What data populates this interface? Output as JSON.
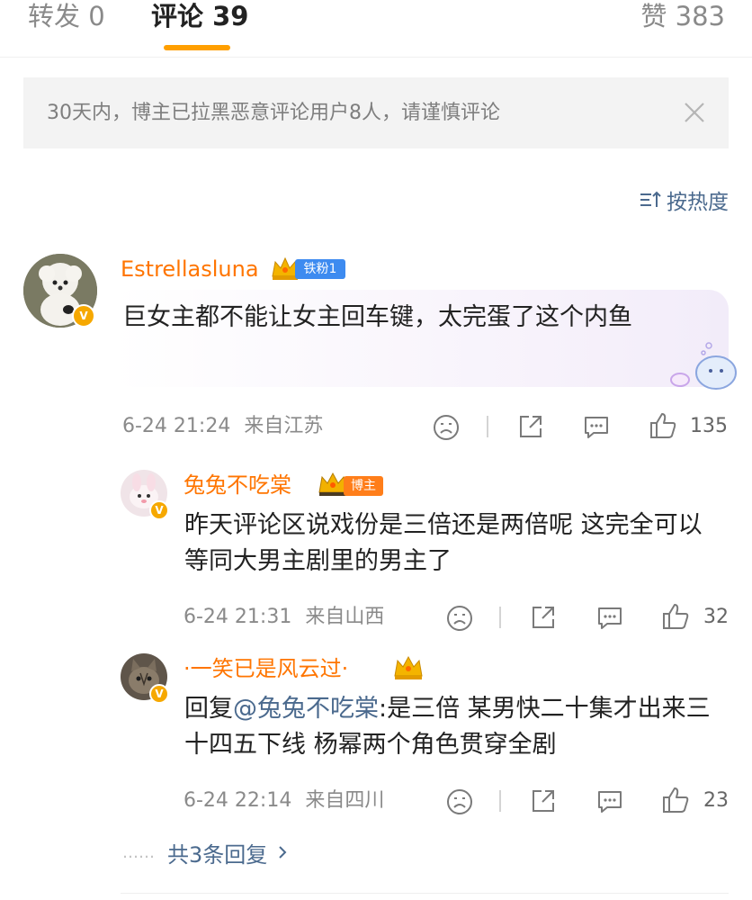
{
  "tabs": {
    "repost": "转发 0",
    "comments": "评论 39",
    "likes": "赞 383"
  },
  "notice": {
    "text": "30天内，博主已拉黑恶意评论用户8人，请谨慎评论"
  },
  "sort": {
    "label": "按热度"
  },
  "comments": [
    {
      "user": "Estrellasluna",
      "fan_badge": "铁粉1",
      "text": "巨女主都不能让女主回车键，太完蛋了这个内鱼",
      "time": "6-24 21:24",
      "location": "来自江苏",
      "likes": "135"
    },
    {
      "user": "兔兔不吃棠",
      "fan_badge": "博主",
      "text": "昨天评论区说戏份是三倍还是两倍呢 这完全可以等同大男主剧里的男主了",
      "time": "6-24 21:31",
      "location": "来自山西",
      "likes": "32"
    },
    {
      "user": "·一笑已是风云过·",
      "reply_prefix": "回复",
      "mention": "@兔兔不吃棠",
      "text": ":是三倍 某男快二十集才出来三十四五下线 杨幂两个角色贯穿全剧",
      "time": "6-24 22:14",
      "location": "来自四川",
      "likes": "23"
    }
  ],
  "more_replies": {
    "dots": "……",
    "label": "共3条回复"
  },
  "colors": {
    "accent_orange": "#ff7500",
    "tab_underline": "#ff9f00",
    "link_blue": "#4b6a8e"
  }
}
